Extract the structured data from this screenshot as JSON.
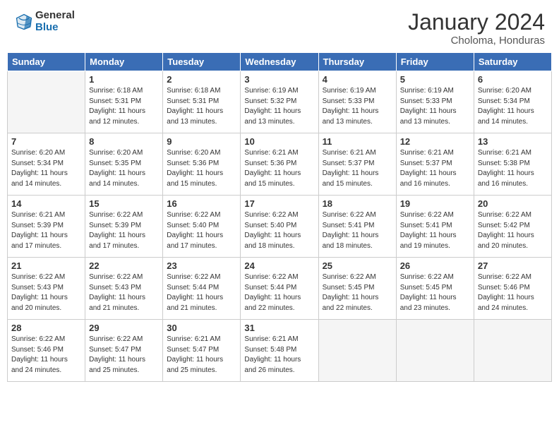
{
  "header": {
    "logo_text_general": "General",
    "logo_text_blue": "Blue",
    "month_year": "January 2024",
    "location": "Choloma, Honduras"
  },
  "days_of_week": [
    "Sunday",
    "Monday",
    "Tuesday",
    "Wednesday",
    "Thursday",
    "Friday",
    "Saturday"
  ],
  "weeks": [
    [
      {
        "day": "",
        "info": ""
      },
      {
        "day": "1",
        "info": "Sunrise: 6:18 AM\nSunset: 5:31 PM\nDaylight: 11 hours\nand 12 minutes."
      },
      {
        "day": "2",
        "info": "Sunrise: 6:18 AM\nSunset: 5:31 PM\nDaylight: 11 hours\nand 13 minutes."
      },
      {
        "day": "3",
        "info": "Sunrise: 6:19 AM\nSunset: 5:32 PM\nDaylight: 11 hours\nand 13 minutes."
      },
      {
        "day": "4",
        "info": "Sunrise: 6:19 AM\nSunset: 5:33 PM\nDaylight: 11 hours\nand 13 minutes."
      },
      {
        "day": "5",
        "info": "Sunrise: 6:19 AM\nSunset: 5:33 PM\nDaylight: 11 hours\nand 13 minutes."
      },
      {
        "day": "6",
        "info": "Sunrise: 6:20 AM\nSunset: 5:34 PM\nDaylight: 11 hours\nand 14 minutes."
      }
    ],
    [
      {
        "day": "7",
        "info": "Sunrise: 6:20 AM\nSunset: 5:34 PM\nDaylight: 11 hours\nand 14 minutes."
      },
      {
        "day": "8",
        "info": "Sunrise: 6:20 AM\nSunset: 5:35 PM\nDaylight: 11 hours\nand 14 minutes."
      },
      {
        "day": "9",
        "info": "Sunrise: 6:20 AM\nSunset: 5:36 PM\nDaylight: 11 hours\nand 15 minutes."
      },
      {
        "day": "10",
        "info": "Sunrise: 6:21 AM\nSunset: 5:36 PM\nDaylight: 11 hours\nand 15 minutes."
      },
      {
        "day": "11",
        "info": "Sunrise: 6:21 AM\nSunset: 5:37 PM\nDaylight: 11 hours\nand 15 minutes."
      },
      {
        "day": "12",
        "info": "Sunrise: 6:21 AM\nSunset: 5:37 PM\nDaylight: 11 hours\nand 16 minutes."
      },
      {
        "day": "13",
        "info": "Sunrise: 6:21 AM\nSunset: 5:38 PM\nDaylight: 11 hours\nand 16 minutes."
      }
    ],
    [
      {
        "day": "14",
        "info": "Sunrise: 6:21 AM\nSunset: 5:39 PM\nDaylight: 11 hours\nand 17 minutes."
      },
      {
        "day": "15",
        "info": "Sunrise: 6:22 AM\nSunset: 5:39 PM\nDaylight: 11 hours\nand 17 minutes."
      },
      {
        "day": "16",
        "info": "Sunrise: 6:22 AM\nSunset: 5:40 PM\nDaylight: 11 hours\nand 17 minutes."
      },
      {
        "day": "17",
        "info": "Sunrise: 6:22 AM\nSunset: 5:40 PM\nDaylight: 11 hours\nand 18 minutes."
      },
      {
        "day": "18",
        "info": "Sunrise: 6:22 AM\nSunset: 5:41 PM\nDaylight: 11 hours\nand 18 minutes."
      },
      {
        "day": "19",
        "info": "Sunrise: 6:22 AM\nSunset: 5:41 PM\nDaylight: 11 hours\nand 19 minutes."
      },
      {
        "day": "20",
        "info": "Sunrise: 6:22 AM\nSunset: 5:42 PM\nDaylight: 11 hours\nand 20 minutes."
      }
    ],
    [
      {
        "day": "21",
        "info": "Sunrise: 6:22 AM\nSunset: 5:43 PM\nDaylight: 11 hours\nand 20 minutes."
      },
      {
        "day": "22",
        "info": "Sunrise: 6:22 AM\nSunset: 5:43 PM\nDaylight: 11 hours\nand 21 minutes."
      },
      {
        "day": "23",
        "info": "Sunrise: 6:22 AM\nSunset: 5:44 PM\nDaylight: 11 hours\nand 21 minutes."
      },
      {
        "day": "24",
        "info": "Sunrise: 6:22 AM\nSunset: 5:44 PM\nDaylight: 11 hours\nand 22 minutes."
      },
      {
        "day": "25",
        "info": "Sunrise: 6:22 AM\nSunset: 5:45 PM\nDaylight: 11 hours\nand 22 minutes."
      },
      {
        "day": "26",
        "info": "Sunrise: 6:22 AM\nSunset: 5:45 PM\nDaylight: 11 hours\nand 23 minutes."
      },
      {
        "day": "27",
        "info": "Sunrise: 6:22 AM\nSunset: 5:46 PM\nDaylight: 11 hours\nand 24 minutes."
      }
    ],
    [
      {
        "day": "28",
        "info": "Sunrise: 6:22 AM\nSunset: 5:46 PM\nDaylight: 11 hours\nand 24 minutes."
      },
      {
        "day": "29",
        "info": "Sunrise: 6:22 AM\nSunset: 5:47 PM\nDaylight: 11 hours\nand 25 minutes."
      },
      {
        "day": "30",
        "info": "Sunrise: 6:21 AM\nSunset: 5:47 PM\nDaylight: 11 hours\nand 25 minutes."
      },
      {
        "day": "31",
        "info": "Sunrise: 6:21 AM\nSunset: 5:48 PM\nDaylight: 11 hours\nand 26 minutes."
      },
      {
        "day": "",
        "info": ""
      },
      {
        "day": "",
        "info": ""
      },
      {
        "day": "",
        "info": ""
      }
    ]
  ]
}
